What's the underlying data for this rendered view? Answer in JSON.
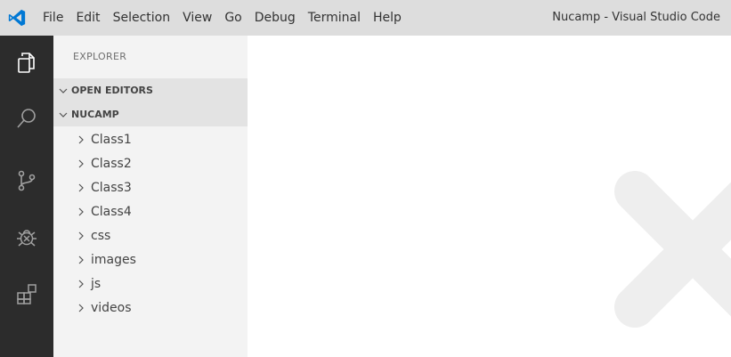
{
  "titlebar": {
    "menu": [
      "File",
      "Edit",
      "Selection",
      "View",
      "Go",
      "Debug",
      "Terminal",
      "Help"
    ],
    "title": "Nucamp - Visual Studio Code",
    "logo_icon": "vscode-logo-icon"
  },
  "activitybar": {
    "icons": [
      "files-icon",
      "search-icon",
      "source-control-icon",
      "debug-icon",
      "extensions-icon"
    ]
  },
  "sidebar": {
    "title": "EXPLORER",
    "sections": [
      {
        "label": "OPEN EDITORS",
        "expanded": true
      },
      {
        "label": "NUCAMP",
        "expanded": true
      }
    ],
    "items": [
      {
        "label": "Class1"
      },
      {
        "label": "Class2"
      },
      {
        "label": "Class3"
      },
      {
        "label": "Class4"
      },
      {
        "label": "css"
      },
      {
        "label": "images"
      },
      {
        "label": "js"
      },
      {
        "label": "videos"
      }
    ]
  },
  "colors": {
    "titlebar_bg": "#dddddd",
    "activitybar_bg": "#2c2c2c",
    "sidebar_bg": "#f3f3f3",
    "section_header_bg": "#e3e3e3",
    "logo_blue": "#0078d4",
    "watermark": "#eeeeee"
  }
}
